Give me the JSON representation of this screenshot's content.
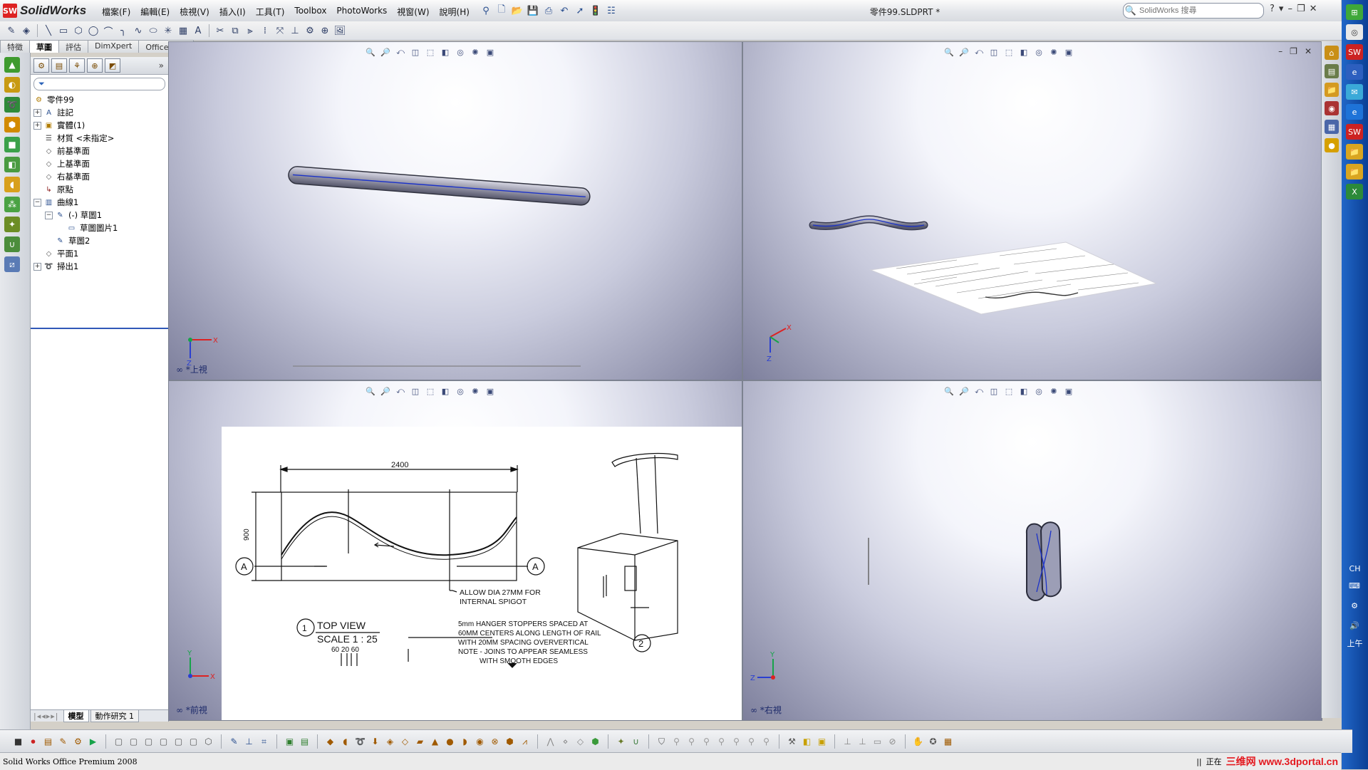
{
  "app": {
    "name": "SolidWorks",
    "logo_mark": "SW",
    "doc_title": "零件99.SLDPRT *",
    "menus": [
      "檔案(F)",
      "編輯(E)",
      "檢視(V)",
      "插入(I)",
      "工具(T)",
      "Toolbox",
      "PhotoWorks",
      "視窗(W)",
      "說明(H)"
    ],
    "search_placeholder": "SolidWorks 搜尋",
    "window_controls": [
      "?",
      "▾",
      "–",
      "❐",
      "✕"
    ]
  },
  "command_tabs": [
    {
      "label": "特徵",
      "active": false
    },
    {
      "label": "草圖",
      "active": true
    },
    {
      "label": "評估",
      "active": false
    },
    {
      "label": "DimXpert",
      "active": false
    },
    {
      "label": "Office 產品",
      "active": false
    }
  ],
  "tree": {
    "expand_more": "»",
    "root": "零件99",
    "nodes": [
      {
        "label": "註記",
        "expander": "+",
        "indent": 0,
        "icon": "annotation-icon",
        "glyph": "A"
      },
      {
        "label": "實體(1)",
        "expander": "+",
        "indent": 0,
        "icon": "solid-bodies-icon",
        "glyph": "▣"
      },
      {
        "label": "材質 <未指定>",
        "expander": "",
        "indent": 0,
        "icon": "material-icon",
        "glyph": "☰"
      },
      {
        "label": "前基準面",
        "expander": "",
        "indent": 0,
        "icon": "plane-icon",
        "glyph": "◇"
      },
      {
        "label": "上基準面",
        "expander": "",
        "indent": 0,
        "icon": "plane-icon",
        "glyph": "◇"
      },
      {
        "label": "右基準面",
        "expander": "",
        "indent": 0,
        "icon": "plane-icon",
        "glyph": "◇"
      },
      {
        "label": "原點",
        "expander": "",
        "indent": 0,
        "icon": "origin-icon",
        "glyph": "↳"
      },
      {
        "label": "曲線1",
        "expander": "−",
        "indent": 0,
        "icon": "curve-icon",
        "glyph": "▥"
      },
      {
        "label": "(-) 草圖1",
        "expander": "−",
        "indent": 1,
        "icon": "sketch-icon",
        "glyph": "✎"
      },
      {
        "label": "草圖圖片1",
        "expander": "",
        "indent": 2,
        "icon": "sketch-picture-icon",
        "glyph": "▭"
      },
      {
        "label": "草圖2",
        "expander": "",
        "indent": 1,
        "icon": "sketch-icon",
        "glyph": "✎"
      },
      {
        "label": "平面1",
        "expander": "",
        "indent": 0,
        "icon": "plane-icon",
        "glyph": "◇"
      },
      {
        "label": "掃出1",
        "expander": "+",
        "indent": 0,
        "icon": "sweep-icon",
        "glyph": "➰"
      }
    ],
    "bottom_tabs": [
      {
        "label": "模型",
        "active": true
      },
      {
        "label": "動作研究 1",
        "active": false
      }
    ]
  },
  "viewports": {
    "top_left_label": "*上視",
    "top_right_label": "",
    "bottom_left_label": "*前視",
    "bottom_right_label": "*右視"
  },
  "drawing": {
    "dim_width": "2400",
    "dim_height": "900",
    "section_marker": "A",
    "note_allow": "ALLOW DIA 27MM FOR",
    "note_allow2": "INTERNAL SPIGOT",
    "view_number": "1",
    "view_title": "TOP  VIEW",
    "view_scale": "SCALE  1 : 25",
    "stopper_note": [
      "5mm HANGER STOPPERS SPACED AT",
      "60MM CENTERS ALONG LENGTH OF RAIL",
      "WITH 20MM SPACING OVERVERTICAL",
      "NOTE - JOINS TO APPEAR SEAMLESS",
      "WITH SMOOTH EDGES"
    ],
    "spacing_dims": "60  20  60",
    "detail_marker": "2"
  },
  "axes": {
    "x": "X",
    "y": "Y",
    "z": "Z"
  },
  "status": {
    "left": "Solid Works Office Premium 2008",
    "right_text": "正在",
    "watermark": "三维网 www.3dportal.cn"
  },
  "system_tray": {
    "lang": "CH",
    "clock": "上午"
  },
  "colors": {
    "accent": "#2a4f8f",
    "sidebar_blue": "#1a56b8",
    "watermark_red": "#e4191f"
  }
}
